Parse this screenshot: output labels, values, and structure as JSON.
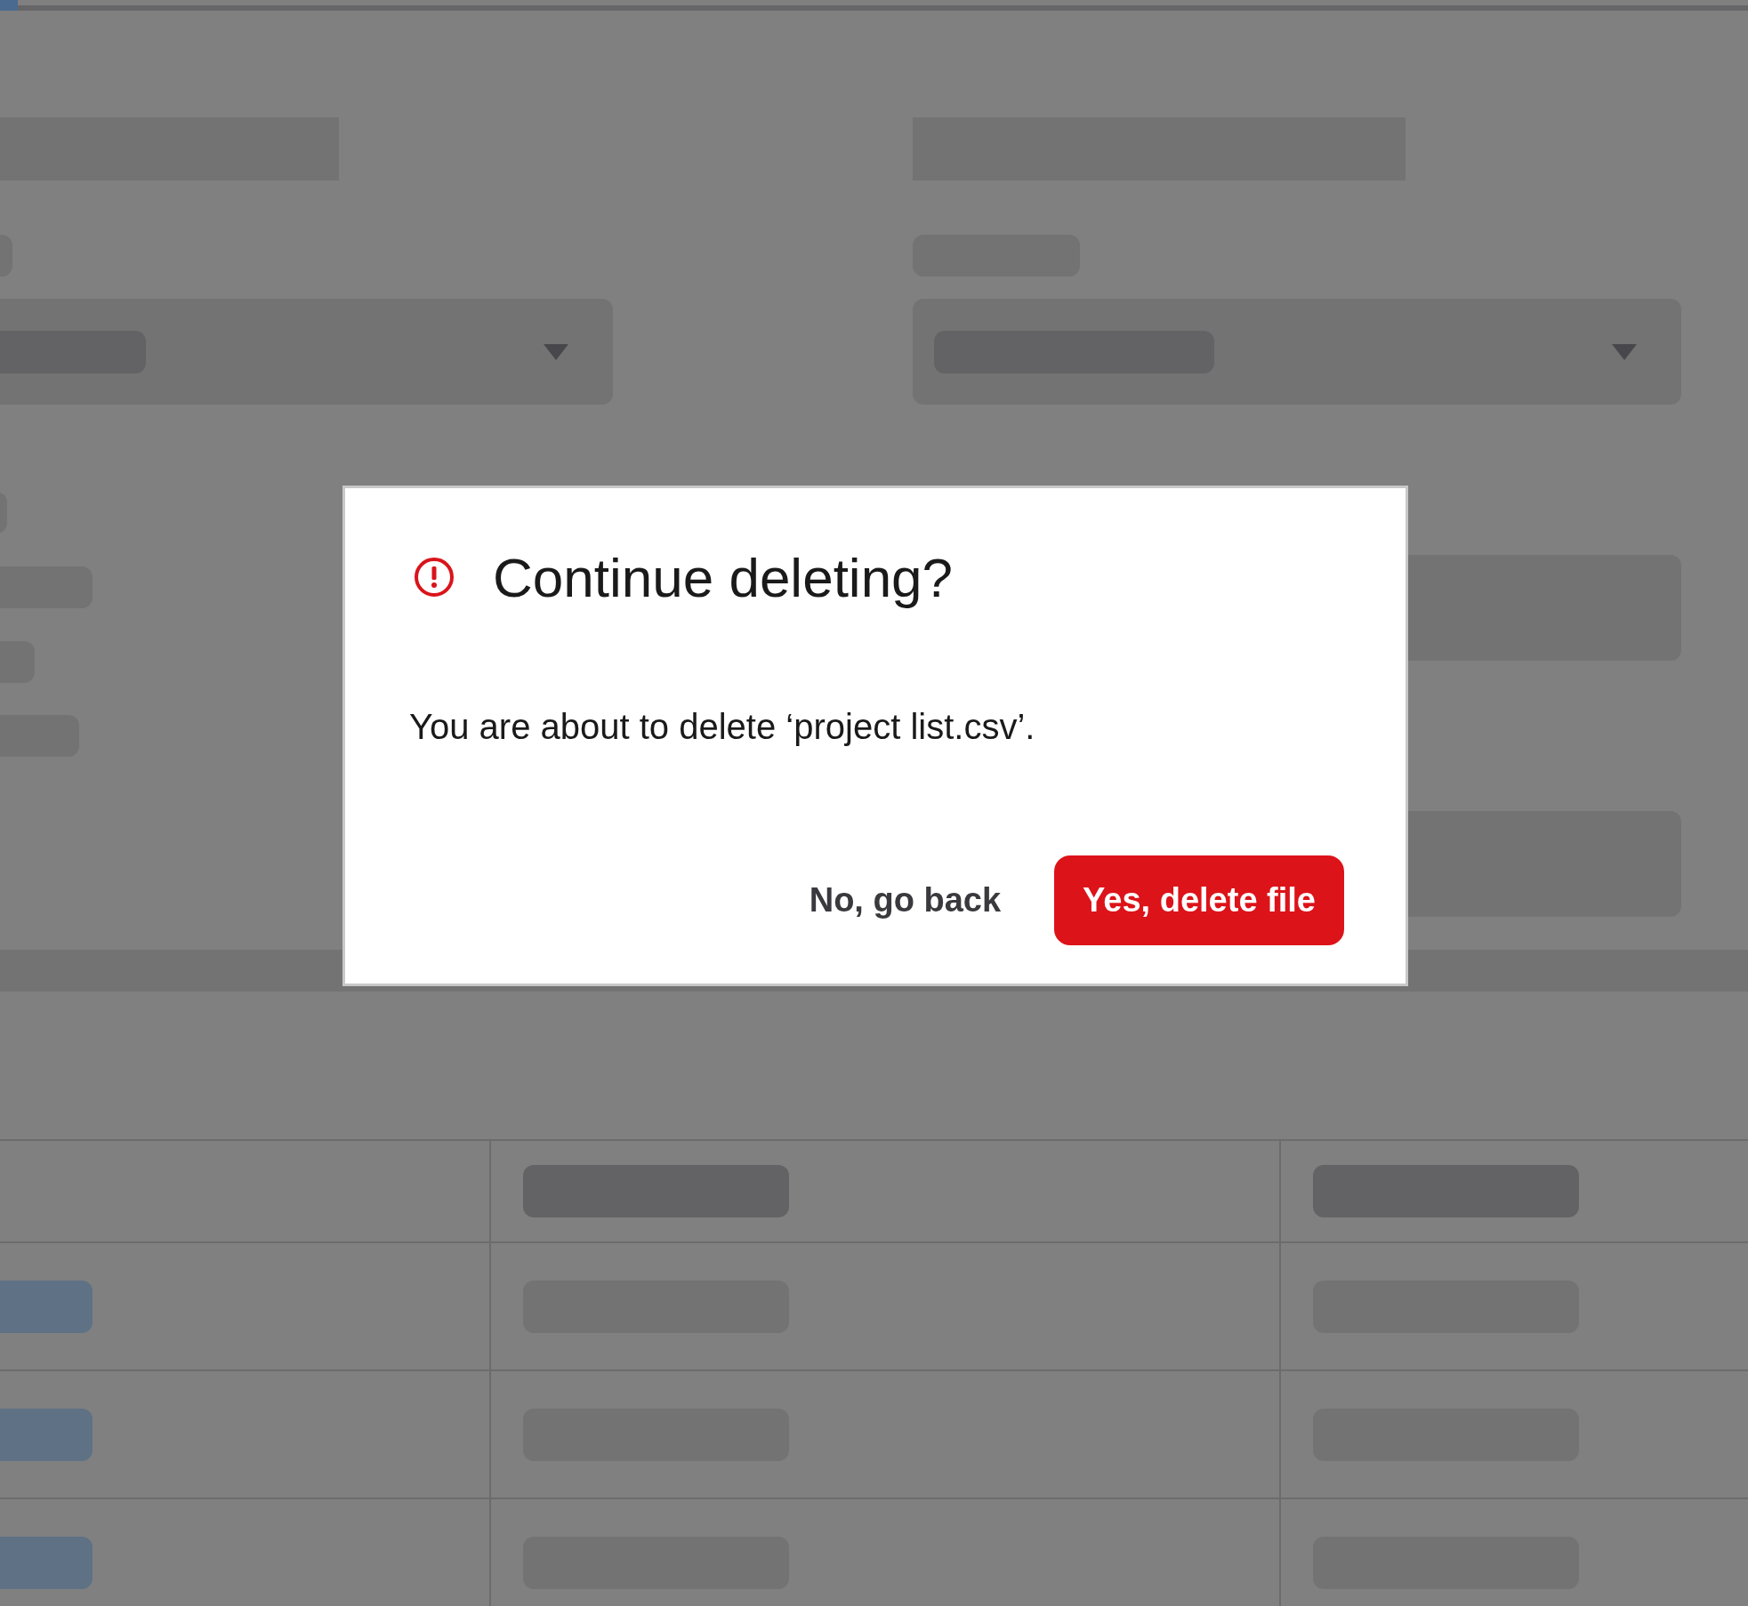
{
  "progress": {
    "level": 0.01
  },
  "dialog": {
    "title": "Continue deleting?",
    "message": "You are about to delete ‘project list.csv’.",
    "buttons": [
      {
        "label": "No, go back",
        "kind": "secondary"
      },
      {
        "label": "Yes, delete file",
        "kind": "danger"
      }
    ]
  }
}
